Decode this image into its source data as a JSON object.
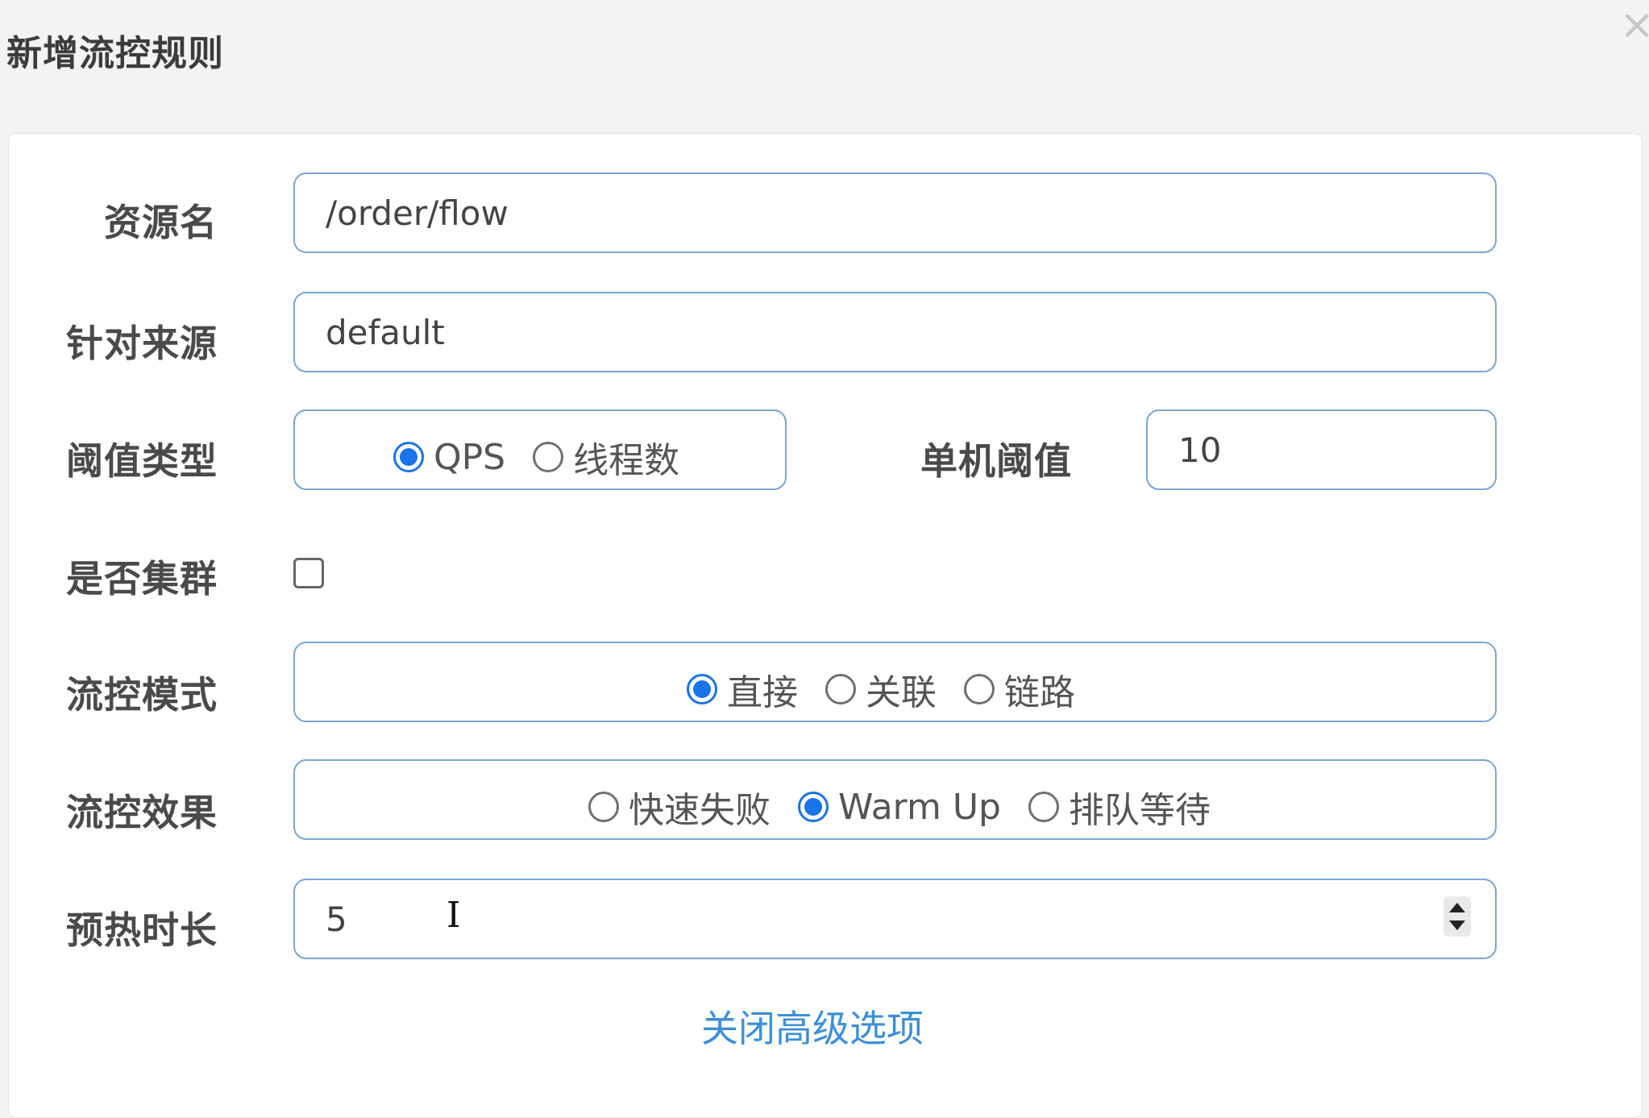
{
  "dialog": {
    "title": "新增流控规则",
    "close_glyph": "×"
  },
  "form": {
    "resource_name": {
      "label": "资源名",
      "value": "/order/flow"
    },
    "limit_app": {
      "label": "针对来源",
      "value": "default"
    },
    "threshold_type": {
      "label": "阈值类型",
      "options": [
        "QPS",
        "线程数"
      ],
      "selected": "QPS"
    },
    "threshold": {
      "label": "单机阈值",
      "value": "10"
    },
    "cluster": {
      "label": "是否集群",
      "checked": false
    },
    "control_mode": {
      "label": "流控模式",
      "options": [
        "直接",
        "关联",
        "链路"
      ],
      "selected": "直接"
    },
    "control_effect": {
      "label": "流控效果",
      "options": [
        "快速失败",
        "Warm Up",
        "排队等待"
      ],
      "selected": "Warm Up"
    },
    "warmup_period": {
      "label": "预热时长",
      "value": "5"
    },
    "advanced_link": "关闭高级选项"
  },
  "colors": {
    "accent": "#1a73e8",
    "input_border": "#7aa6d2",
    "link": "#3d8fd8"
  },
  "icons": {
    "close": "close-icon",
    "spinner": "number-spinner-icon",
    "text_cursor": "text-cursor-icon"
  }
}
